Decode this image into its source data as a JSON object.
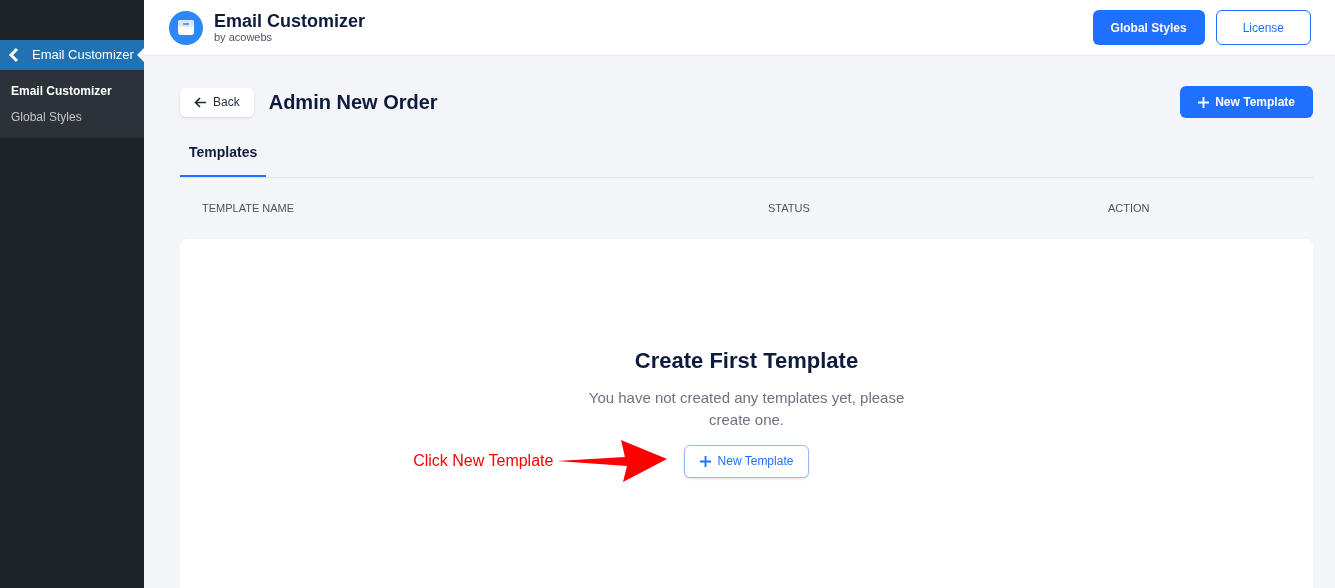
{
  "sidebar": {
    "menu_item": "Email Customizer",
    "submenu": [
      {
        "label": "Email Customizer",
        "selected": true
      },
      {
        "label": "Global Styles",
        "selected": false
      }
    ]
  },
  "header": {
    "app_name": "Email Customizer",
    "byline": "by acowebs",
    "buttons": [
      {
        "label": "Global Styles",
        "kind": "primary"
      },
      {
        "label": "License",
        "kind": "outline"
      }
    ]
  },
  "page": {
    "back": "Back",
    "title": "Admin New Order",
    "new_button": "New Template"
  },
  "tabs": [
    {
      "label": "Templates",
      "selected": true
    }
  ],
  "table": {
    "columns": [
      "TEMPLATE NAME",
      "STATUS",
      "ACTION"
    ]
  },
  "empty_state": {
    "title": "Create First Template",
    "message": "You have not created any templates yet, please create one.",
    "button": "New Template"
  },
  "annotation": {
    "text": "Click New Template"
  }
}
